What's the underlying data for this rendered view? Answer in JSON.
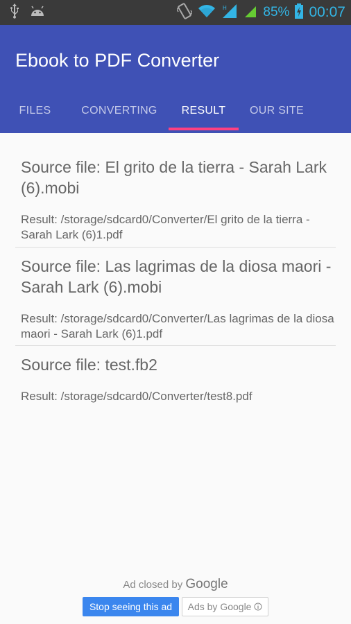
{
  "status_bar": {
    "battery_percent": "85%",
    "time": "00:07",
    "icons": [
      "usb-icon",
      "android-icon",
      "vibrate-icon",
      "wifi-icon",
      "signal-icon",
      "signal2-icon",
      "battery-charging-icon"
    ],
    "accent_color": "#33b5e5"
  },
  "app_bar": {
    "title": "Ebook to PDF Converter",
    "color": "#3f51b5"
  },
  "tabs": [
    {
      "label": "FILES"
    },
    {
      "label": "CONVERTING"
    },
    {
      "label": "RESULT",
      "active": true
    },
    {
      "label": "OUR SITE"
    }
  ],
  "tab_indicator_color": "#ff4081",
  "results": [
    {
      "source": "Source file: El grito de la tierra - Sarah Lark (6).mobi",
      "result": "Result: /storage/sdcard0/Converter/El grito de la tierra - Sarah Lark (6)1.pdf"
    },
    {
      "source": "Source file: Las lagrimas de la diosa maori - Sarah Lark (6).mobi",
      "result": "Result: /storage/sdcard0/Converter/Las lagrimas de la diosa maori - Sarah Lark (6)1.pdf"
    },
    {
      "source": "Source file: test.fb2",
      "result": "Result: /storage/sdcard0/Converter/test8.pdf"
    }
  ],
  "ad": {
    "closed_text": "Ad closed by",
    "brand": "Google",
    "stop_button": "Stop seeing this ad",
    "ads_by": "Ads by Google",
    "stop_button_color": "#3b86ee"
  }
}
